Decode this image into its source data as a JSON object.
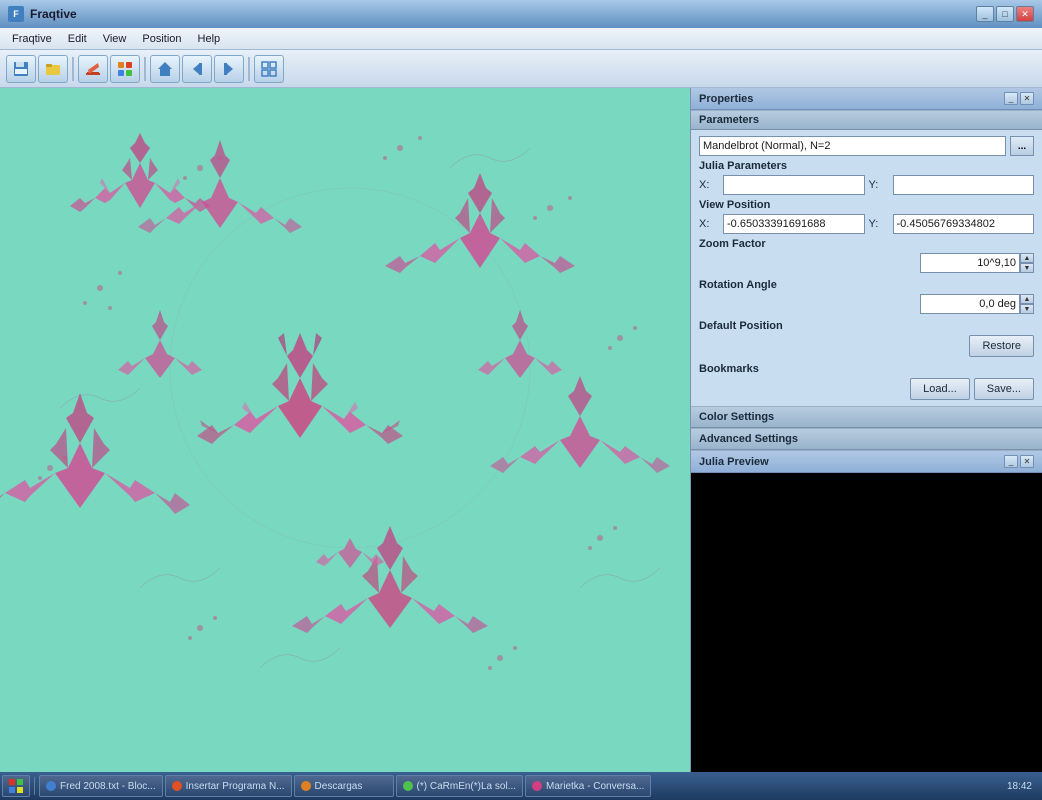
{
  "window": {
    "title": "Fraqtive",
    "icon": "F"
  },
  "menu": {
    "items": [
      "Fraqtive",
      "Edit",
      "View",
      "Position",
      "Help"
    ]
  },
  "toolbar": {
    "buttons": [
      {
        "icon": "💾",
        "label": "save",
        "name": "save-button"
      },
      {
        "icon": "📂",
        "label": "open",
        "name": "open-button"
      },
      {
        "icon": "✏️",
        "label": "edit",
        "name": "edit-button"
      },
      {
        "icon": "🟧",
        "label": "color",
        "name": "color-button"
      },
      {
        "icon": "🏠",
        "label": "home",
        "name": "home-button"
      },
      {
        "icon": "◀",
        "label": "back",
        "name": "back-button"
      },
      {
        "icon": "▶",
        "label": "forward",
        "name": "forward-button"
      },
      {
        "icon": "⊞",
        "label": "view",
        "name": "view-button"
      }
    ]
  },
  "properties": {
    "title": "Properties",
    "sections": {
      "parameters": {
        "label": "Parameters",
        "fractal_type": "Mandelbrot (Normal), N=2",
        "fractal_btn": "...",
        "julia_label": "Julia Parameters",
        "julia_x_label": "X:",
        "julia_x_value": "",
        "julia_y_label": "Y:",
        "julia_y_value": "",
        "view_position_label": "View Position",
        "view_x_label": "X:",
        "view_x_value": "-0.65033391691688",
        "view_y_label": "Y:",
        "view_y_value": "-0.45056769334802",
        "zoom_label": "Zoom Factor",
        "zoom_value": "10^9,10",
        "rotation_label": "Rotation Angle",
        "rotation_value": "0,0 deg",
        "default_pos_label": "Default Position",
        "restore_btn": "Restore",
        "bookmarks_label": "Bookmarks",
        "load_btn": "Load...",
        "save_btn": "Save..."
      },
      "color_settings": {
        "label": "Color Settings"
      },
      "advanced_settings": {
        "label": "Advanced Settings"
      }
    }
  },
  "julia_preview": {
    "title": "Julia Preview"
  },
  "taskbar": {
    "start_icon": "⊞",
    "items": [
      {
        "label": "Fred 2008.txt - Bloc...",
        "color": "#4080d0"
      },
      {
        "label": "Insertar Programa N...",
        "color": "#e05020"
      },
      {
        "label": "Descargas",
        "color": "#e08020"
      },
      {
        "label": "(*) CaRmEn(*)La sol...",
        "color": "#50c050"
      },
      {
        "label": "Marietka - Conversa...",
        "color": "#d04080"
      }
    ],
    "clock": "18:42"
  }
}
